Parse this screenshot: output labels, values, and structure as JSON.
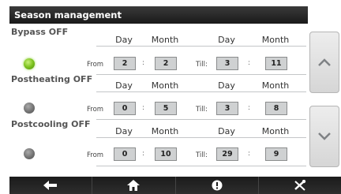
{
  "title": "Season management",
  "headers": {
    "day": "Day",
    "month": "Month"
  },
  "labels": {
    "from": "From",
    "till": "Till:",
    "separator": ":"
  },
  "modes": [
    {
      "name": "Bypass OFF",
      "status": "active",
      "from_day": "2",
      "from_month": "2",
      "till_day": "3",
      "till_month": "11"
    },
    {
      "name": "Postheating OFF",
      "status": "inactive",
      "from_day": "0",
      "from_month": "5",
      "till_day": "3",
      "till_month": "8"
    },
    {
      "name": "Postcooling OFF",
      "status": "inactive",
      "from_day": "0",
      "from_month": "10",
      "till_day": "29",
      "till_month": "9"
    }
  ],
  "nav": {
    "scroll_up_icon": "chevron-up-icon",
    "scroll_down_icon": "chevron-down-icon",
    "bottom_icons": [
      "back-arrow-icon",
      "home-icon",
      "info-icon",
      "tools-icon"
    ]
  },
  "colors": {
    "led_active": "#7dc21e",
    "led_inactive": "#6e6e6e",
    "title_bar": "#1a1a1a",
    "value_box": "#cfd1d2"
  }
}
